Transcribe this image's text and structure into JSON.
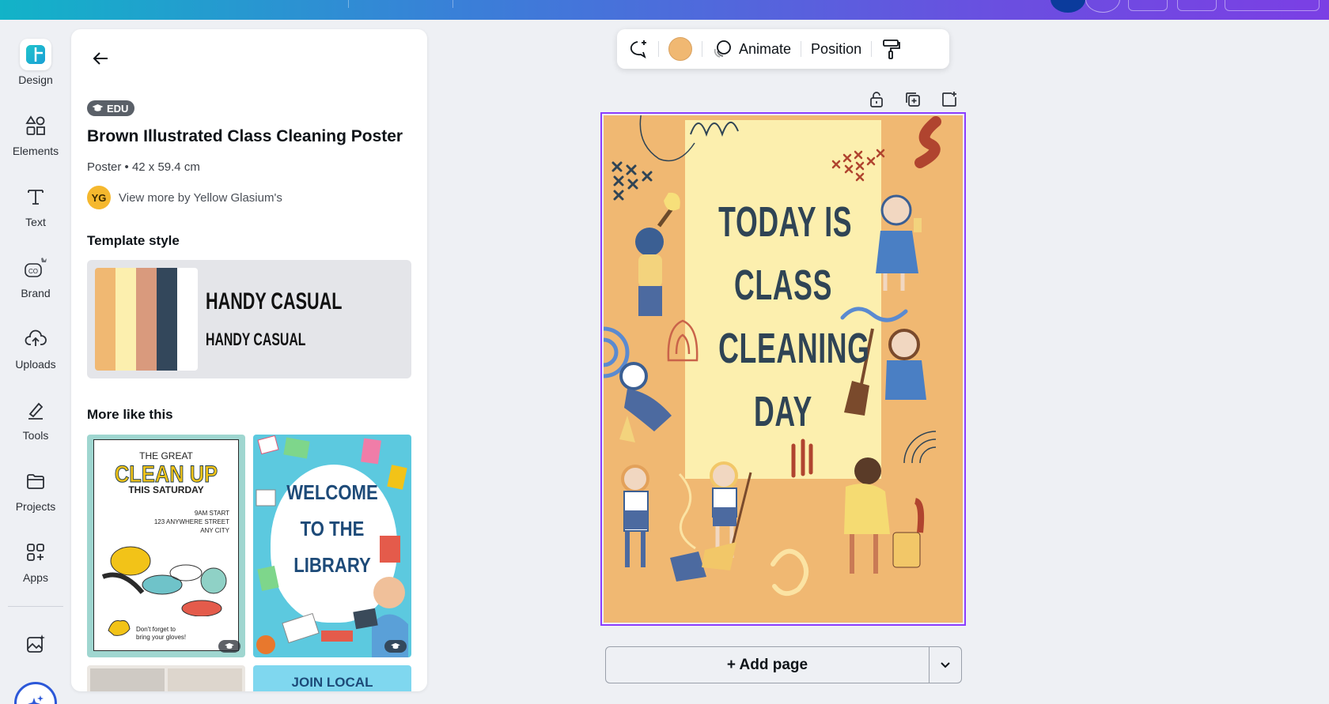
{
  "colors": {
    "brand_gradient": [
      "#12b3c8",
      "#3a7fd8",
      "#6a4fe0",
      "#7b3fe4"
    ],
    "selection": "#8b3dff",
    "poster_bg": "#f0b872",
    "poster_center": "#fcefae",
    "poster_text": "#2f4455"
  },
  "rail": {
    "items": [
      {
        "label": "Design",
        "icon": "design-icon"
      },
      {
        "label": "Elements",
        "icon": "elements-icon"
      },
      {
        "label": "Text",
        "icon": "text-icon"
      },
      {
        "label": "Brand",
        "icon": "brand-icon"
      },
      {
        "label": "Uploads",
        "icon": "uploads-icon"
      },
      {
        "label": "Tools",
        "icon": "tools-icon"
      },
      {
        "label": "Projects",
        "icon": "projects-icon"
      },
      {
        "label": "Apps",
        "icon": "apps-icon"
      }
    ]
  },
  "panel": {
    "badge": "EDU",
    "title": "Brown Illustrated Class Cleaning Poster",
    "meta": "Poster • 42 x 59.4 cm",
    "author_initials": "YG",
    "author_link": "View more by Yellow Glasium's",
    "template_style_heading": "Template style",
    "style_font_big": "HANDY CASUAL",
    "style_font_small": "HANDY CASUAL",
    "palette": [
      "#f0b872",
      "#fcefae",
      "#d99a7d",
      "#33475b",
      "#ffffff"
    ],
    "more_heading": "More like this",
    "thumbs": [
      {
        "lines": [
          "THE GREAT",
          "CLEAN UP",
          "THIS SATURDAY",
          "9AM START",
          "123 ANYWHERE STREET",
          "ANY CITY",
          "Don't forget to",
          "bring your gloves!"
        ]
      },
      {
        "lines": [
          "WELCOME",
          "TO THE",
          "LIBRARY"
        ]
      },
      {
        "lines": []
      },
      {
        "lines": [
          "JOIN LOCAL"
        ]
      }
    ]
  },
  "toolbar": {
    "animate": "Animate",
    "position": "Position"
  },
  "poster": {
    "lines": [
      "TODAY IS",
      "CLASS",
      "CLEANING",
      "DAY"
    ]
  },
  "add_page": "+ Add page"
}
